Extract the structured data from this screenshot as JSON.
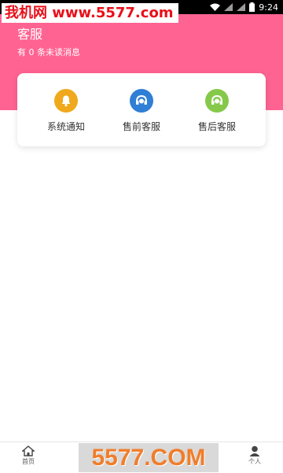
{
  "status_bar": {
    "time": "9:24"
  },
  "watermark": {
    "text": "我机网 www.5577.com"
  },
  "header": {
    "title": "客服",
    "unread_text": "有 0 条未读消息"
  },
  "service_card": {
    "items": [
      {
        "label": "系统通知",
        "icon": "bell-icon",
        "color": "#f0a81c"
      },
      {
        "label": "售前客服",
        "icon": "headset-icon",
        "color": "#2f7fd6"
      },
      {
        "label": "售后客服",
        "icon": "headset-icon",
        "color": "#86c94a"
      }
    ]
  },
  "tabbar": {
    "tabs": [
      {
        "label": "首页",
        "icon": "home-icon"
      },
      {
        "label": "个人",
        "icon": "person-icon"
      }
    ]
  },
  "logo_overlay": {
    "text": "5577.COM"
  },
  "colors": {
    "header_bg": "#ff6392",
    "watermark_red": "#e8101a"
  }
}
